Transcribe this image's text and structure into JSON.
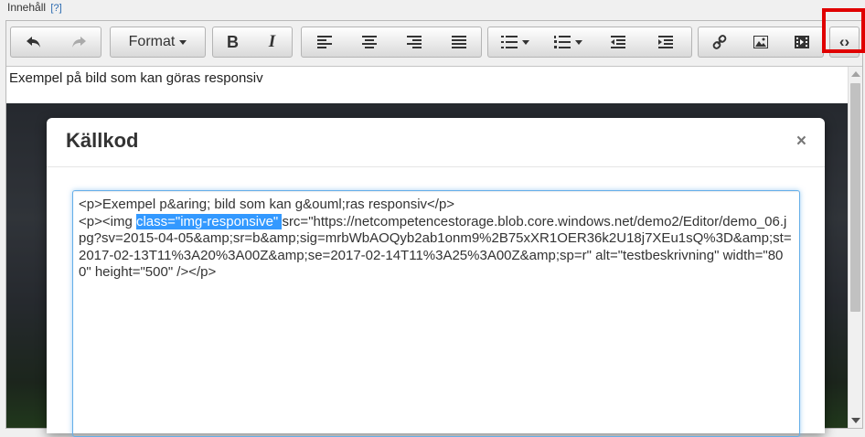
{
  "field": {
    "label": "Innehåll",
    "help": "[?]"
  },
  "toolbar": {
    "format_label": "Format",
    "bold_label": "B",
    "italic_label": "I",
    "source_code_glyph": "‹›"
  },
  "content": {
    "text": "Exempel på bild som kan göras responsiv"
  },
  "modal": {
    "title": "Källkod",
    "close_glyph": "×",
    "code_line1": "<p>Exempel p&aring; bild som kan g&ouml;ras responsiv</p>",
    "code_before_sel": "<p><img ",
    "code_selected": "class=\"img-responsive\" ",
    "code_after_sel": "src=\"https://netcompetencestorage.blob.core.windows.net/demo2/Editor/demo_06.jpg?sv=2015-04-05&amp;sr=b&amp;sig=mrbWbAOQyb2ab1onm9%2B75xXR1OER36k2U18j7XEu1sQ%3D&amp;st=2017-02-13T11%3A20%3A00Z&amp;se=2017-02-14T11%3A25%3A00Z&amp;sp=r\" alt=\"testbeskrivning\" width=\"800\" height=\"500\" /></p>"
  },
  "colors": {
    "highlight_border": "#e00000",
    "selection": "#3399ff",
    "focus_border": "#66afe9"
  }
}
